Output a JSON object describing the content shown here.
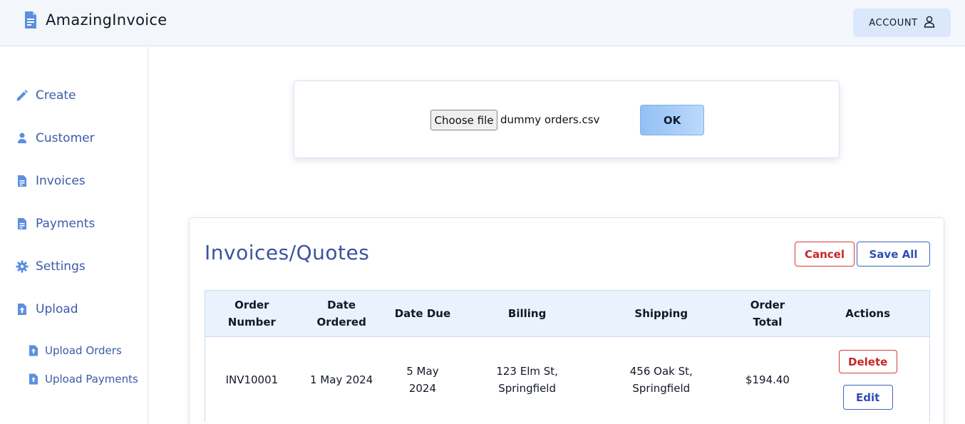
{
  "header": {
    "app_name": "AmazingInvoice",
    "account_label": "ACCOUNT",
    "brand_icon": "document-icon",
    "account_icon": "user-icon"
  },
  "sidebar": {
    "items": [
      {
        "label": "Create",
        "icon": "pencil-icon"
      },
      {
        "label": "Customer",
        "icon": "user-icon"
      },
      {
        "label": "Invoices",
        "icon": "document-icon"
      },
      {
        "label": "Payments",
        "icon": "document-icon"
      },
      {
        "label": "Settings",
        "icon": "gear-icon"
      },
      {
        "label": "Upload",
        "icon": "upload-file-icon"
      }
    ],
    "sub_items": [
      {
        "label": "Upload Orders",
        "icon": "upload-file-icon"
      },
      {
        "label": "Upload Payments",
        "icon": "upload-file-icon"
      }
    ]
  },
  "upload": {
    "choose_label": "Choose file",
    "file_name": "dummy orders.csv",
    "ok_label": "OK"
  },
  "invoices": {
    "title": "Invoices/Quotes",
    "cancel_label": "Cancel",
    "save_all_label": "Save All",
    "columns": [
      "Order\nNumber",
      "Date\nOrdered",
      "Date Due",
      "Billing",
      "Shipping",
      "Order\nTotal",
      "Actions"
    ],
    "rows": [
      {
        "order_number": "INV10001",
        "date_ordered": "1 May 2024",
        "date_due": "5 May\n2024",
        "billing": "123 Elm St,\nSpringfield",
        "shipping": "456 Oak St,\nSpringfield",
        "order_total": "$194.40",
        "delete_label": "Delete",
        "edit_label": "Edit"
      }
    ]
  },
  "colors": {
    "accent": "#3b5aa8",
    "header_bg": "#f3f7fc",
    "danger": "#c62828",
    "primary_outline": "#3d63c9"
  }
}
